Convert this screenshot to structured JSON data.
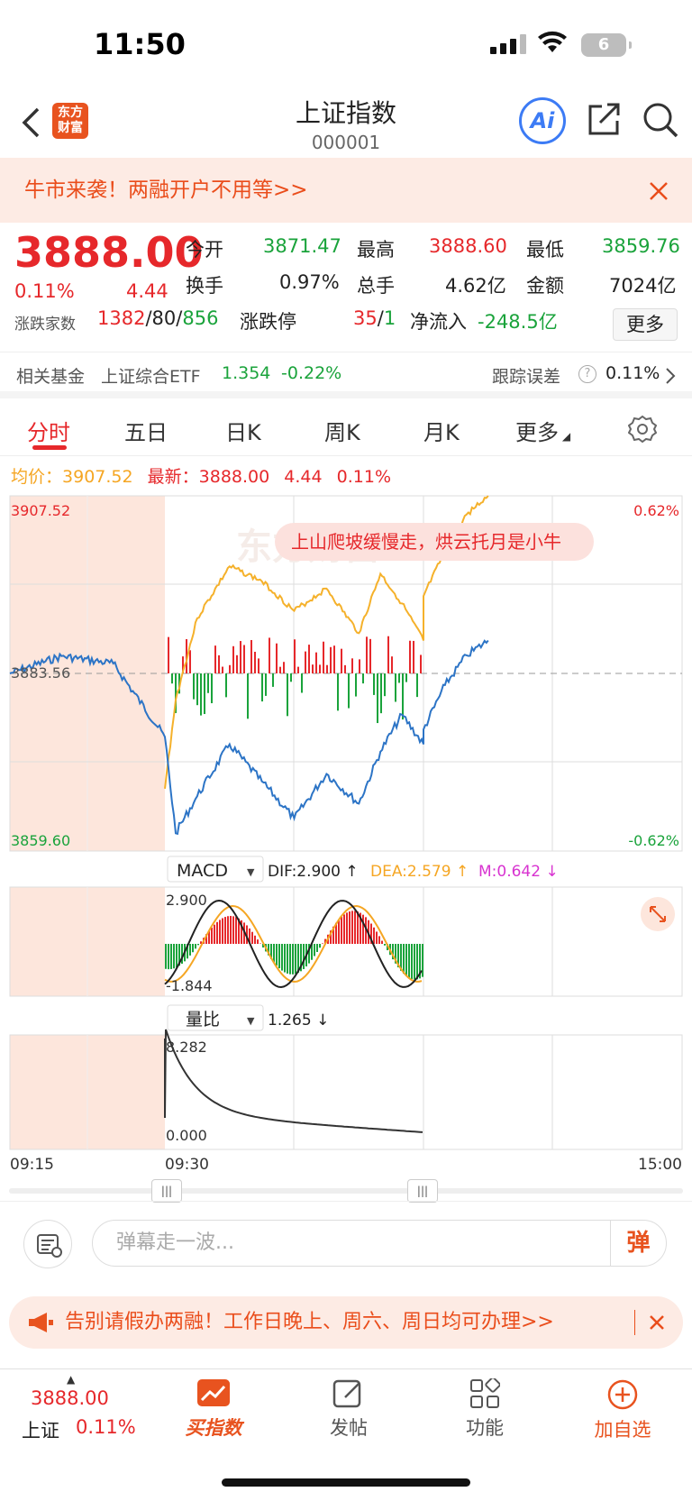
{
  "status": {
    "time": "11:50",
    "battery": "6"
  },
  "nav": {
    "logo": "东方财富",
    "title": "上证指数",
    "code": "000001",
    "ai_label": "Ai"
  },
  "promo": {
    "text": "牛市来袭！两融开户不用等>>"
  },
  "quote": {
    "price": "3888.00",
    "change_pct": "0.11%",
    "change": "4.44",
    "open_label": "今开",
    "open": "3871.47",
    "high_label": "最高",
    "high": "3888.60",
    "low_label": "最低",
    "low": "3859.76",
    "turnover_label": "换手",
    "turnover": "0.97%",
    "volume_label": "总手",
    "volume": "4.62亿",
    "amount_label": "金额",
    "amount": "7024亿",
    "breadth_label": "涨跌家数",
    "up": "1382",
    "flat": "80",
    "down": "856",
    "limit_label": "涨跌停",
    "limit_up": "35",
    "limit_down": "1",
    "flow_label": "净流入",
    "flow": "-248.5亿",
    "more": "更多"
  },
  "fund": {
    "label": "相关基金",
    "name": "上证综合ETF",
    "price": "1.354",
    "chg": "-0.22%",
    "track_label": "跟踪误差",
    "track": "0.11%"
  },
  "tabs": [
    "分时",
    "五日",
    "日K",
    "周K",
    "月K",
    "更多"
  ],
  "avgline": {
    "avg_label": "均价：",
    "avg": "3907.52",
    "last_label": "最新：",
    "last": "3888.00",
    "chg": "4.44",
    "pct": "0.11%"
  },
  "chart_labels": {
    "top_price": "3907.52",
    "mid_price": "3883.56",
    "bottom_price": "3859.60",
    "top_pct": "0.62%",
    "bottom_pct": "-0.62%",
    "bubble": "上山爬坡缓慢走，烘云托月是小牛",
    "watermark": "东方财富",
    "macd_sel": "MACD",
    "dif": "DIF:2.900 ↑",
    "dea": "DEA:2.579 ↑",
    "m": "M:0.642 ↓",
    "macd_top": "2.900",
    "macd_bot": "-1.844",
    "vr_sel": "量比",
    "vr_val": "1.265 ↓",
    "vr_top": "8.282",
    "vr_bot": "0.000",
    "t_start": "09:15",
    "t_open": "09:30",
    "t_end": "15:00"
  },
  "chart_data": {
    "type": "line",
    "title": "",
    "series": [
      {
        "name": "最新",
        "x": [
          "09:15",
          "09:20",
          "09:25",
          "09:30",
          "09:35",
          "09:45",
          "10:00",
          "10:15",
          "10:30",
          "10:45",
          "11:00",
          "11:10",
          "11:20",
          "11:30",
          "13:00",
          "13:10",
          "13:20",
          "13:30"
        ],
        "values": [
          3883.56,
          3885.9,
          3884.9,
          3875.0,
          3862.0,
          3867.0,
          3874.0,
          3869.0,
          3864.0,
          3870.0,
          3866.0,
          3873.0,
          3878.0,
          3874.0,
          3876.0,
          3882.0,
          3886.0,
          3888.0
        ]
      },
      {
        "name": "均价",
        "x": [
          "09:30",
          "09:35",
          "09:45",
          "10:00",
          "10:15",
          "10:30",
          "10:45",
          "11:00",
          "11:10",
          "11:20",
          "11:30",
          "13:00",
          "13:10",
          "13:20",
          "13:30"
        ],
        "values": [
          3868.0,
          3880.0,
          3891.0,
          3898.0,
          3896.0,
          3892.0,
          3895.0,
          3889.0,
          3897.0,
          3893.0,
          3888.0,
          3894.0,
          3900.0,
          3905.0,
          3907.52
        ]
      }
    ],
    "ylim": [
      3859.6,
      3907.52
    ]
  },
  "danmu": {
    "placeholder": "弹幕走一波...",
    "btn": "弹"
  },
  "notice": {
    "text": "告别请假办两融！工作日晚上、周六、周日均可办理>>"
  },
  "bottom": {
    "price": "3888.00",
    "name": "上证",
    "pct": "0.11%",
    "buy": "买指数",
    "post": "发帖",
    "func": "功能",
    "fav": "加自选"
  }
}
